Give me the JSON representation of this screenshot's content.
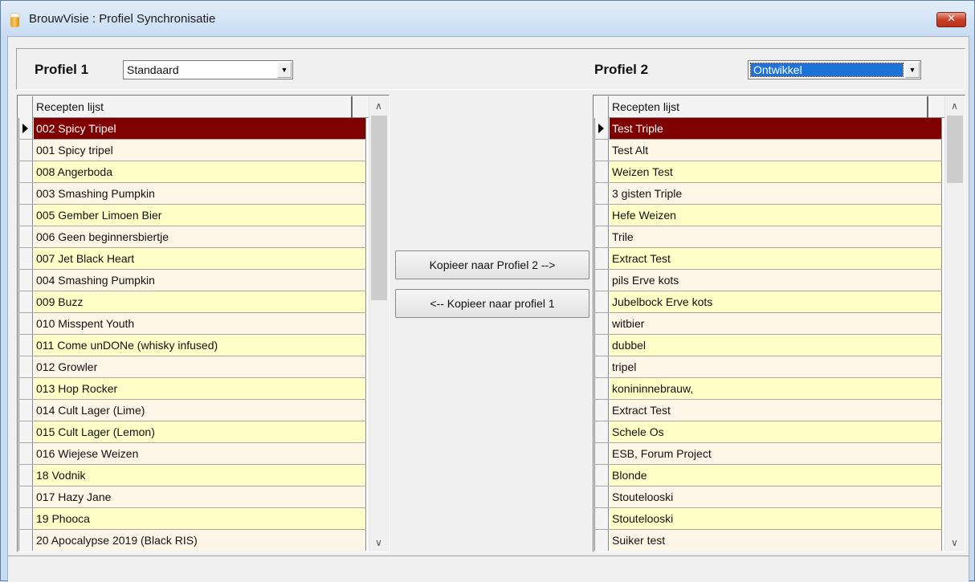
{
  "window": {
    "title": "BrouwVisie : Profiel Synchronisatie",
    "close_glyph": "✕",
    "app_icon": "beer-glass-icon"
  },
  "profile1": {
    "label": "Profiel 1",
    "selected": "Standaard",
    "grid": {
      "column": "Recepten lijst",
      "rows": [
        "002 Spicy Tripel",
        "001 Spicy tripel",
        "008 Angerboda",
        "003 Smashing Pumpkin",
        "005 Gember Limoen Bier",
        "006 Geen beginnersbiertje",
        "007 Jet Black Heart",
        "004 Smashing Pumpkin",
        "009 Buzz",
        "010 Misspent Youth",
        "011 Come unDONe (whisky infused)",
        "012 Growler",
        "013 Hop Rocker",
        "014 Cult Lager (Lime)",
        "015 Cult Lager (Lemon)",
        "016 Wiejese Weizen",
        "18 Vodnik",
        "017 Hazy Jane",
        "19 Phooca",
        "20 Apocalypse 2019 (Black RIS)"
      ],
      "selected_index": 0,
      "scroll_fraction": 0.45
    }
  },
  "profile2": {
    "label": "Profiel 2",
    "selected": "Ontwikkel",
    "grid": {
      "column": "Recepten lijst",
      "rows": [
        "Test Triple",
        "Test Alt",
        "Weizen Test",
        "3 gisten Triple",
        "Hefe Weizen",
        "Trile",
        "Extract Test",
        "pils Erve kots",
        "Jubelbock Erve kots",
        "witbier",
        "dubbel",
        "tripel",
        "konininnebrauw,",
        "Extract Test",
        "Schele Os",
        "ESB, Forum Project",
        "Blonde",
        "Stoutelooski",
        "Stoutelooski",
        "Suiker test"
      ],
      "selected_index": 0,
      "scroll_fraction": 0.16
    }
  },
  "buttons": {
    "copy_to_2": "Kopieer naar Profiel 2 -->",
    "copy_to_1": "<-- Kopieer naar profiel 1"
  },
  "colors": {
    "selected_row": "#800000",
    "row_odd": "#fdf5e6",
    "row_even": "#ffffc8"
  }
}
